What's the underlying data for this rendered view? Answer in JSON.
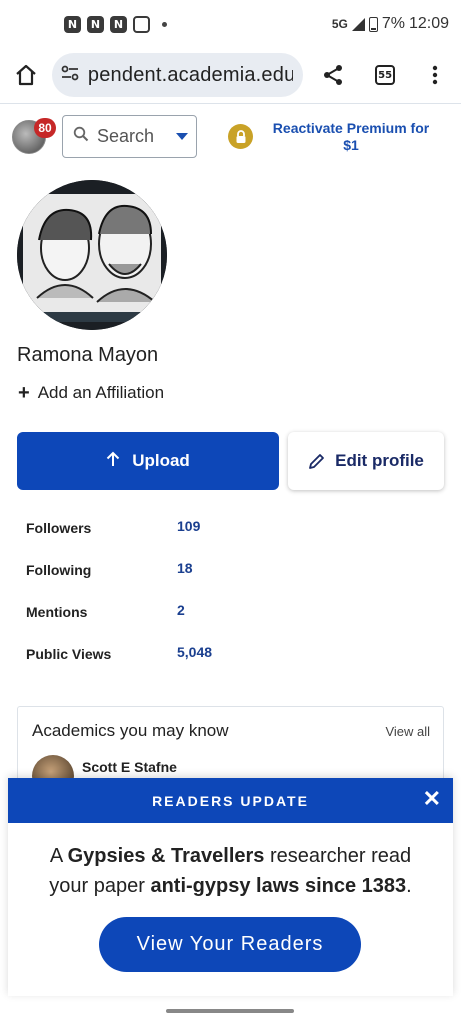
{
  "status_bar": {
    "app_icons": [
      "N",
      "N",
      "N"
    ],
    "network": "5G",
    "battery": "7%",
    "time": "12:09"
  },
  "browser": {
    "url": "pendent.academia.edu",
    "tab_count": "55"
  },
  "header": {
    "notification_count": "80",
    "search_label": "Search",
    "premium_link": "Reactivate Premium for $1"
  },
  "profile": {
    "name": "Ramona Mayon",
    "add_affiliation": "Add an Affiliation",
    "upload_label": "Upload",
    "edit_label": "Edit profile"
  },
  "stats": [
    {
      "label": "Followers",
      "value": "109"
    },
    {
      "label": "Following",
      "value": "18"
    },
    {
      "label": "Mentions",
      "value": "2"
    },
    {
      "label": "Public Views",
      "value": "5,048"
    }
  ],
  "academics": {
    "title": "Academics you may know",
    "view_all": "View all",
    "people": [
      "Scott E Stafne"
    ]
  },
  "readers_update": {
    "heading": "READERS UPDATE",
    "msg_a": "A ",
    "msg_topic": "Gypsies & Travellers",
    "msg_b": " researcher read your paper ",
    "msg_paper": "anti-gypsy laws since 1383",
    "msg_c": ".",
    "button": "View Your Readers"
  },
  "colors": {
    "primary": "#0d47b8",
    "link": "#1a4fb0",
    "badge": "#c62828",
    "lock": "#c9a227"
  }
}
